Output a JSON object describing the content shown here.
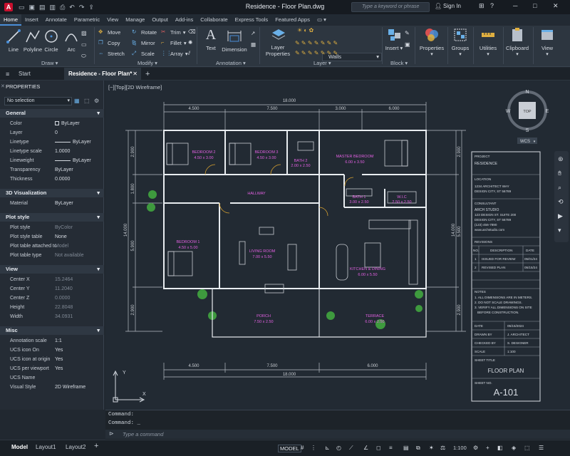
{
  "window": {
    "title": "Residence - Floor Plan.dwg",
    "search_placeholder": "Type a keyword or phrase",
    "sign_in": "Sign In"
  },
  "ribbon": {
    "tabs": [
      "Home",
      "Insert",
      "Annotate",
      "Parametric",
      "View",
      "Manage",
      "Output",
      "Add-ins",
      "Collaborate",
      "Express Tools",
      "Featured Apps"
    ],
    "active_tab": "Home",
    "draw": {
      "line": "Line",
      "polyline": "Polyline",
      "circle": "Circle",
      "arc": "Arc",
      "panel": "Draw"
    },
    "modify": {
      "move": "Move",
      "rotate": "Rotate",
      "trim": "Trim",
      "copy": "Copy",
      "mirror": "Mirror",
      "fillet": "Fillet",
      "stretch": "Stretch",
      "scale": "Scale",
      "array": "Array",
      "panel": "Modify"
    },
    "annotation": {
      "text": "Text",
      "dimension": "Dimension",
      "panel": "Annotation"
    },
    "layers": {
      "layer_properties": "Layer Properties",
      "current_layer": "Walls",
      "panel": "Layer"
    },
    "block": {
      "insert": "Insert",
      "panel": "Block"
    },
    "properties": "Properties",
    "groups": "Groups",
    "utilities": "Utilities",
    "clipboard": "Clipboard",
    "view": "View"
  },
  "file_tabs": {
    "start": "Start",
    "active": "Residence - Floor Plan*"
  },
  "properties_panel": {
    "title": "PROPERTIES",
    "selection": "No selection",
    "general": {
      "title": "General",
      "rows": [
        {
          "label": "Color",
          "value": "ByLayer"
        },
        {
          "label": "Layer",
          "value": "0"
        },
        {
          "label": "Linetype",
          "value": "ByLayer"
        },
        {
          "label": "Linetype scale",
          "value": "1.0000"
        },
        {
          "label": "Lineweight",
          "value": "ByLayer"
        },
        {
          "label": "Transparency",
          "value": "ByLayer"
        },
        {
          "label": "Thickness",
          "value": "0.0000"
        }
      ]
    },
    "viz": {
      "title": "3D Visualization",
      "rows": [
        {
          "label": "Material",
          "value": "ByLayer"
        }
      ]
    },
    "plot": {
      "title": "Plot style",
      "rows": [
        {
          "label": "Plot style",
          "value": "ByColor"
        },
        {
          "label": "Plot style table",
          "value": "None"
        },
        {
          "label": "Plot table attached to",
          "value": "Model"
        },
        {
          "label": "Plot table type",
          "value": "Not available"
        }
      ]
    },
    "view": {
      "title": "View",
      "rows": [
        {
          "label": "Center X",
          "value": "15.2464"
        },
        {
          "label": "Center Y",
          "value": "11.2040"
        },
        {
          "label": "Center Z",
          "value": "0.0000"
        },
        {
          "label": "Height",
          "value": "22.8048"
        },
        {
          "label": "Width",
          "value": "34.0931"
        }
      ]
    },
    "misc": {
      "title": "Misc",
      "rows": [
        {
          "label": "Annotation scale",
          "value": "1:1"
        },
        {
          "label": "UCS icon On",
          "value": "Yes"
        },
        {
          "label": "UCS icon at origin",
          "value": "Yes"
        },
        {
          "label": "UCS per viewport",
          "value": "Yes"
        },
        {
          "label": "UCS Name",
          "value": ""
        },
        {
          "label": "Visual Style",
          "value": "2D Wireframe"
        }
      ]
    }
  },
  "viewport": {
    "label": "[−][Top][2D Wireframe]"
  },
  "viewcube": {
    "n": "N",
    "s": "S",
    "e": "E",
    "w": "W",
    "top": "TOP",
    "wcs": "WCS"
  },
  "plan": {
    "dim_total": "18.000",
    "dim_top": [
      "4.500",
      "7.500",
      "3.000",
      "6.000"
    ],
    "dim_bottom": [
      "4.500",
      "7.500",
      "6.000"
    ],
    "dim_left_total": "14.000",
    "dim_left": [
      "2.900",
      "1.800",
      "5.900",
      "2.900"
    ],
    "dim_right_total": "14.000",
    "dim_right": [
      "2.900",
      "5.500",
      "2.900"
    ],
    "rooms": [
      {
        "name": "BEDROOM 2",
        "size": "4.50 x 3.00"
      },
      {
        "name": "BEDROOM 3",
        "size": "4.50 x 3.00"
      },
      {
        "name": "BATH 2",
        "size": "2.00 x 2.50"
      },
      {
        "name": "MASTER BEDROOM",
        "size": "6.00 x 3.50"
      },
      {
        "name": "HALLWAY",
        "size": ""
      },
      {
        "name": "BATH 1",
        "size": "3.00 x 2.50"
      },
      {
        "name": "W.I.C",
        "size": "2.50 x 2.50"
      },
      {
        "name": "BEDROOM 1",
        "size": "4.50 x 5.00"
      },
      {
        "name": "LIVING ROOM",
        "size": "7.00 x 5.50"
      },
      {
        "name": "KITCHEN & DINING",
        "size": "6.00 x 5.50"
      },
      {
        "name": "PORCH",
        "size": "7.50 x 2.50"
      },
      {
        "name": "TERRACE",
        "size": "6.00 x 2.50"
      }
    ]
  },
  "title_block": {
    "project_label": "PROJECT",
    "project": "RESIDENCE",
    "location_label": "LOCATION",
    "location": [
      "1234 ARCHITECT WAY",
      "DESIGN CITY, ST 56789"
    ],
    "consultant_label": "CONSULTANT",
    "consultant": [
      "ARCH STUDIO",
      "123 DESIGN ST. SUITE 200",
      "DESIGN CITY, ST 56789",
      "(123) 456-7890",
      "www.archstudio.com"
    ],
    "revisions_label": "REVISIONS",
    "rev_headers": [
      "NO.",
      "DESCRIPTION",
      "DATE"
    ],
    "revisions": [
      {
        "no": "1",
        "desc": "ISSUED FOR REVIEW",
        "date": "05/01/24"
      },
      {
        "no": "2",
        "desc": "REVISED PLAN",
        "date": "05/15/24"
      }
    ],
    "notes_label": "NOTES",
    "notes": [
      "1. ALL DIMENSIONS ARE IN METERS.",
      "2. DO NOT SCALE DRAWINGS.",
      "3. VERIFY ALL DIMENSIONS ON SITE",
      "BEFORE CONSTRUCTION."
    ],
    "date_label": "DATE",
    "date": "05/15/2024",
    "drawn_label": "DRAWN BY",
    "drawn": "J. ARCHITECT",
    "checked_label": "CHECKED BY",
    "checked": "S. DESIGNER",
    "scale_label": "SCALE",
    "scale": "1:100",
    "sheet_title_label": "SHEET TITLE",
    "sheet_title": "FLOOR PLAN",
    "sheet_no_label": "SHEET NO.",
    "sheet_no": "A-101"
  },
  "command": {
    "line1": "Command:",
    "line2": "Command: _",
    "placeholder": "Type a command"
  },
  "status": {
    "model": "Model",
    "layout1": "Layout1",
    "layout2": "Layout2",
    "model_btn": "MODEL",
    "scale": "1:100"
  },
  "colors": {
    "accent": "#4a8fd9",
    "room_label": "#e060e0",
    "walls": "#e8ecf0",
    "dims": "#c8ccd2",
    "plants": "#3e9a3e"
  }
}
